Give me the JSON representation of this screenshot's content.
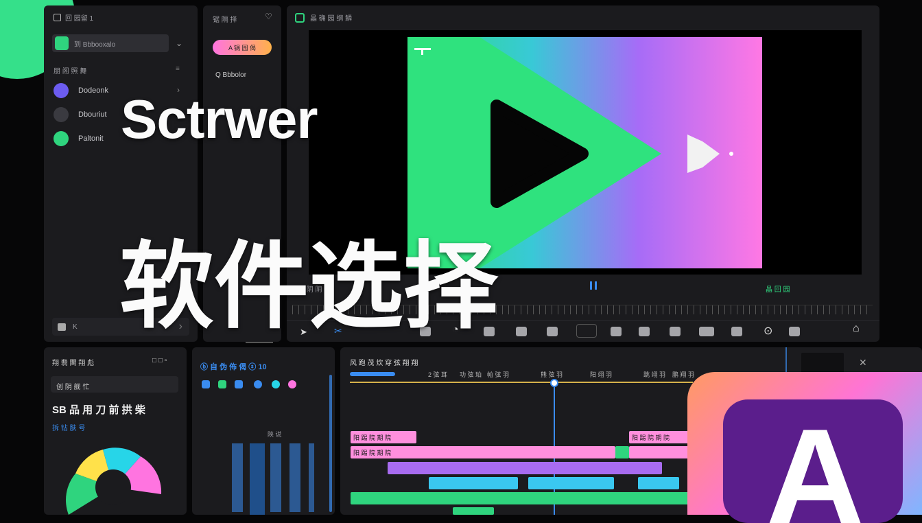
{
  "hero": {
    "title_en": "Sctrwer",
    "title_cn": "软件选择",
    "app_letter": "A"
  },
  "sidebar": {
    "header_label": "回 园留 1",
    "project_label": "到 Bbbooxalo",
    "section_label": "朋 阁 照 舞",
    "items": [
      {
        "label": "Dodeonk",
        "color": "#6c5cf0"
      },
      {
        "label": "Dbouriut",
        "color": "#3a3a40"
      },
      {
        "label": "Paltonit",
        "color": "#2fd47e"
      }
    ],
    "footer_label": "K"
  },
  "effects": {
    "header_label": "锯 隔 择",
    "pill_label": "A 锅 园 偈",
    "search_label": "Q Bbbolor"
  },
  "viewer": {
    "header_label": "晶 确 园 纲 鳞",
    "tc_left": "晶 阴 阴",
    "tc_right": "晶 回 园"
  },
  "properties": {
    "header_label": "翔 翡 関 翔 彪",
    "search_label": "创 阴 舰 忙",
    "heading": "SB 品 用 刀 前 拱 柴",
    "sub_label": "拆 钻 肤 号"
  },
  "media": {
    "header_label": "ⓑ 自 伪 佈 偈  ⓢ 10",
    "grid_label": "陕 说"
  },
  "timeline": {
    "header_label": "风 跑 茂 炊 穿 弦 翔 翔",
    "ticks": [
      "2 弦 耳",
      "功 弦 珀",
      "帕 弦 羽",
      "熊 弦 羽",
      "阳 翊 羽",
      "跳 翊 羽",
      "鹏 翔 羽"
    ],
    "clip_label": "阳 踢 院 期 院"
  },
  "colors": {
    "accent_green": "#2fd47e",
    "accent_pink": "#ff74e0",
    "accent_blue": "#3a8cf0",
    "accent_orange": "#ffb14a",
    "logo_purple": "#5b1e8c"
  }
}
